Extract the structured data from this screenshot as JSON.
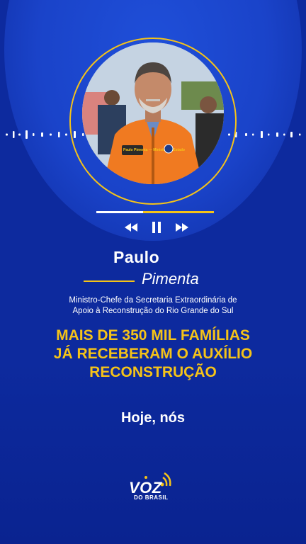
{
  "person": {
    "first_name": "Paulo",
    "last_name": "Pimenta",
    "role_line1": "Ministro-Chefe da Secretaria Extraordinária de",
    "role_line2": "Apoio à Reconstrução do Rio Grande do Sul",
    "badge_text": "Paulo Pimenta — Ministro de Estado"
  },
  "headline": {
    "line1": "MAIS DE 350 MIL FAMÍLIAS",
    "line2": "JÁ RECEBERAM O AUXÍLIO",
    "line3": "RECONSTRUÇÃO"
  },
  "caption": "Hoje, nós",
  "player": {
    "progress": 0.4,
    "controls": [
      "rewind-icon",
      "pause-icon",
      "fast-forward-icon"
    ]
  },
  "brand": {
    "name": "VOZ",
    "sub": "DO BRASIL"
  },
  "colors": {
    "background": "#0d2a9e",
    "accent": "#f5c318",
    "text": "#ffffff"
  }
}
